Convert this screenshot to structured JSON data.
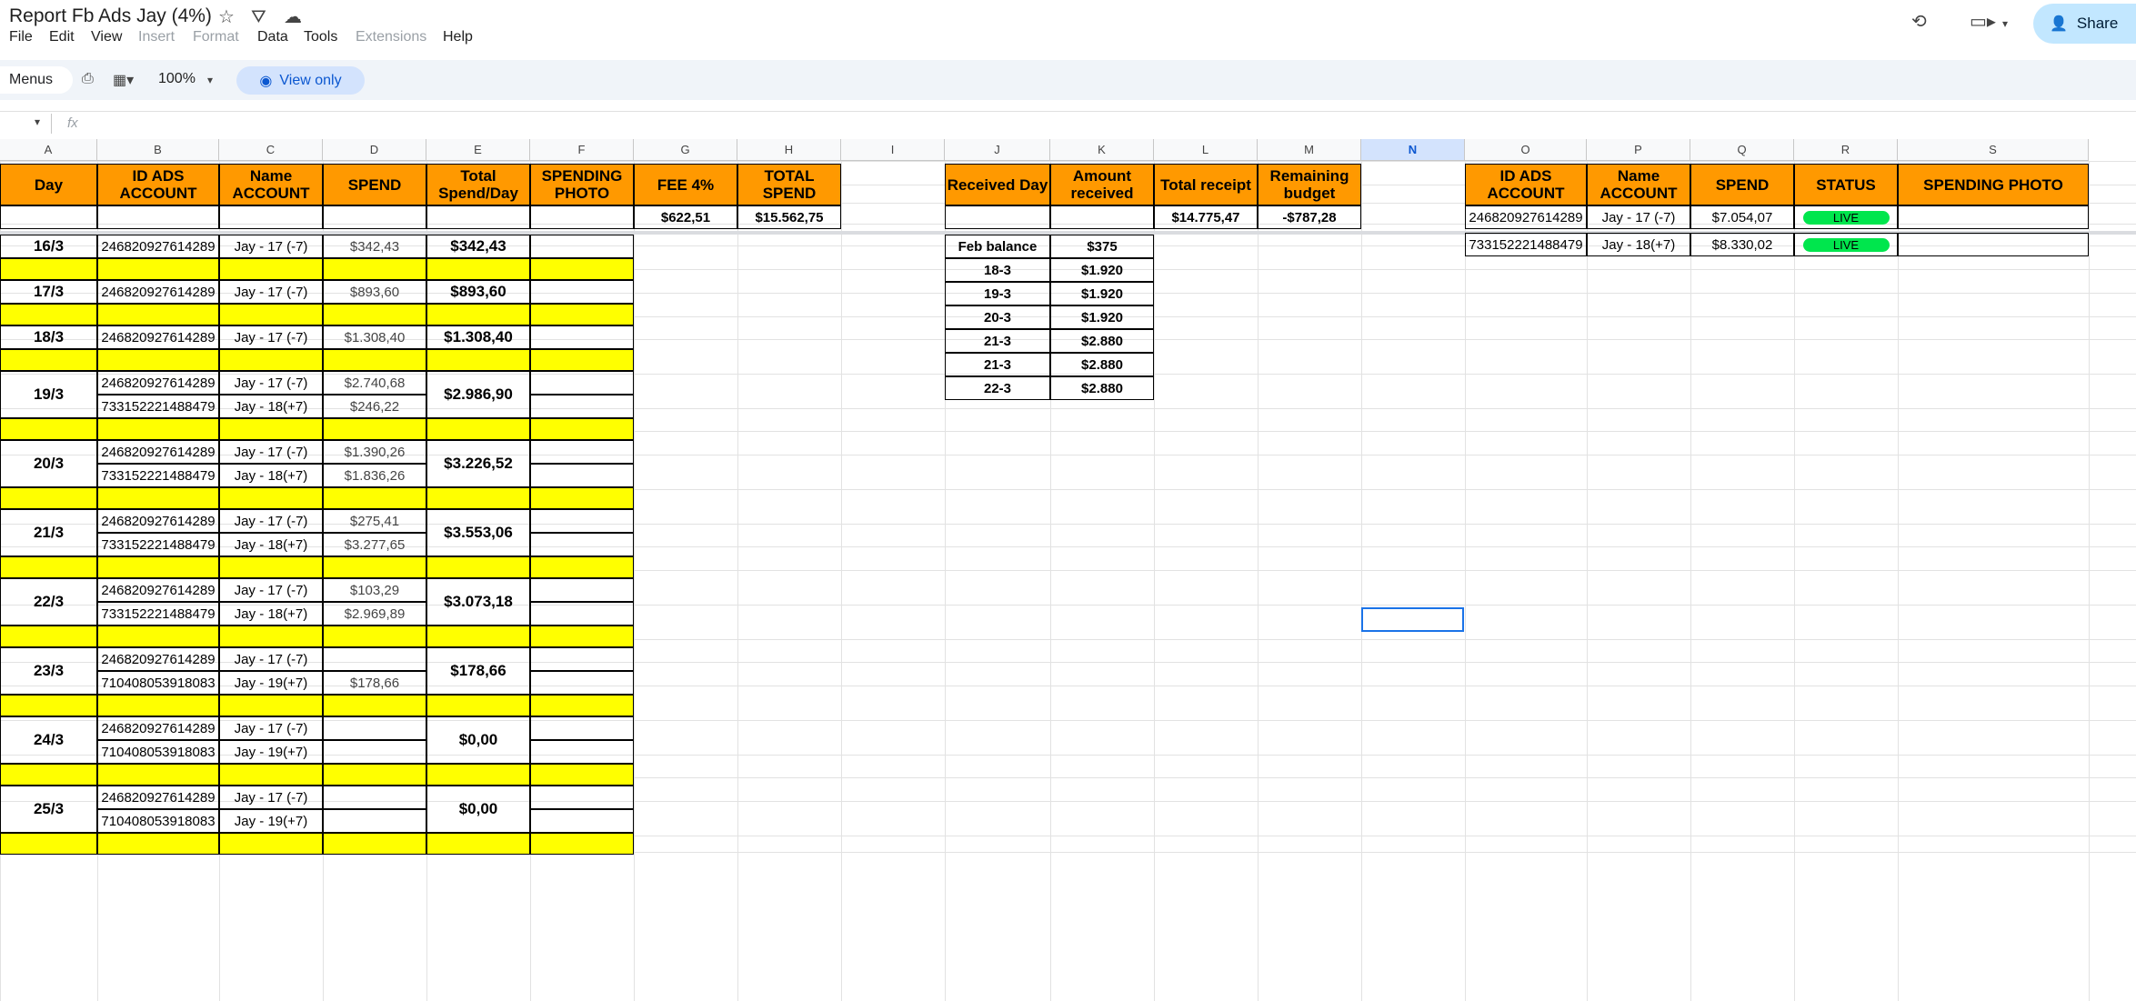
{
  "doc": {
    "title": "Report Fb Ads Jay (4%)"
  },
  "menu": {
    "file": "File",
    "edit": "Edit",
    "view": "View",
    "insert": "Insert",
    "format": "Format",
    "data": "Data",
    "tools": "Tools",
    "extensions": "Extensions",
    "help": "Help"
  },
  "share": {
    "label": "Share"
  },
  "toolbar": {
    "menus": "Menus",
    "zoom": "100%",
    "view_only": "View only"
  },
  "formula": {
    "fx": "fx"
  },
  "columns": [
    "A",
    "B",
    "C",
    "D",
    "E",
    "F",
    "G",
    "H",
    "I",
    "J",
    "K",
    "L",
    "M",
    "N",
    "O",
    "P",
    "Q",
    "R",
    "S"
  ],
  "left": {
    "headers": {
      "day": "Day",
      "id": "ID ADS ACCOUNT",
      "name": "Name ACCOUNT",
      "spend": "SPEND",
      "total": "Total Spend/Day",
      "photo": "SPENDING PHOTO",
      "fee": "FEE 4%",
      "total_spend": "TOTAL SPEND"
    },
    "fee_value": "$622,51",
    "total_spend_value": "$15.562,75",
    "days": [
      {
        "day": "16/3",
        "total": "$342,43",
        "rows": [
          {
            "id": "246820927614289",
            "name": "Jay - 17 (-7)",
            "spend": "$342,43"
          }
        ]
      },
      {
        "day": "17/3",
        "total": "$893,60",
        "rows": [
          {
            "id": "246820927614289",
            "name": "Jay - 17 (-7)",
            "spend": "$893,60"
          }
        ]
      },
      {
        "day": "18/3",
        "total": "$1.308,40",
        "rows": [
          {
            "id": "246820927614289",
            "name": "Jay - 17 (-7)",
            "spend": "$1.308,40"
          }
        ]
      },
      {
        "day": "19/3",
        "total": "$2.986,90",
        "rows": [
          {
            "id": "246820927614289",
            "name": "Jay - 17 (-7)",
            "spend": "$2.740,68"
          },
          {
            "id": "733152221488479",
            "name": "Jay - 18(+7)",
            "spend": "$246,22"
          }
        ]
      },
      {
        "day": "20/3",
        "total": "$3.226,52",
        "rows": [
          {
            "id": "246820927614289",
            "name": "Jay - 17 (-7)",
            "spend": "$1.390,26"
          },
          {
            "id": "733152221488479",
            "name": "Jay - 18(+7)",
            "spend": "$1.836,26"
          }
        ]
      },
      {
        "day": "21/3",
        "total": "$3.553,06",
        "rows": [
          {
            "id": "246820927614289",
            "name": "Jay - 17 (-7)",
            "spend": "$275,41"
          },
          {
            "id": "733152221488479",
            "name": "Jay - 18(+7)",
            "spend": "$3.277,65"
          }
        ]
      },
      {
        "day": "22/3",
        "total": "$3.073,18",
        "rows": [
          {
            "id": "246820927614289",
            "name": "Jay - 17 (-7)",
            "spend": "$103,29"
          },
          {
            "id": "733152221488479",
            "name": "Jay - 18(+7)",
            "spend": "$2.969,89"
          }
        ]
      },
      {
        "day": "23/3",
        "total": "$178,66",
        "rows": [
          {
            "id": "246820927614289",
            "name": "Jay - 17 (-7)",
            "spend": ""
          },
          {
            "id": "710408053918083",
            "name": "Jay - 19(+7)",
            "spend": "$178,66"
          }
        ]
      },
      {
        "day": "24/3",
        "total": "$0,00",
        "rows": [
          {
            "id": "246820927614289",
            "name": "Jay - 17 (-7)",
            "spend": ""
          },
          {
            "id": "710408053918083",
            "name": "Jay - 19(+7)",
            "spend": ""
          }
        ]
      },
      {
        "day": "25/3",
        "total": "$0,00",
        "rows": [
          {
            "id": "246820927614289",
            "name": "Jay - 17 (-7)",
            "spend": ""
          },
          {
            "id": "710408053918083",
            "name": "Jay - 19(+7)",
            "spend": ""
          }
        ]
      }
    ]
  },
  "middle": {
    "headers": {
      "received_day": "Received Day",
      "amount": "Amount received",
      "total_receipt": "Total receipt",
      "remaining": "Remaining budget"
    },
    "total_receipt_value": "$14.775,47",
    "remaining_value": "-$787,28",
    "rows": [
      {
        "day": "Feb balance",
        "amount": "$375"
      },
      {
        "day": "18-3",
        "amount": "$1.920"
      },
      {
        "day": "19-3",
        "amount": "$1.920"
      },
      {
        "day": "20-3",
        "amount": "$1.920"
      },
      {
        "day": "21-3",
        "amount": "$2.880"
      },
      {
        "day": "21-3",
        "amount": "$2.880"
      },
      {
        "day": "22-3",
        "amount": "$2.880"
      }
    ]
  },
  "right": {
    "headers": {
      "id": "ID ADS ACCOUNT",
      "name": "Name ACCOUNT",
      "spend": "SPEND",
      "status": "STATUS",
      "photo": "SPENDING PHOTO"
    },
    "rows": [
      {
        "id": "246820927614289",
        "name": "Jay - 17 (-7)",
        "spend": "$7.054,07",
        "status": "LIVE"
      },
      {
        "id": "733152221488479",
        "name": "Jay - 18(+7)",
        "spend": "$8.330,02",
        "status": "LIVE"
      }
    ]
  },
  "colors": {
    "orange": "#ff9900",
    "yellow": "#ffff00",
    "live": "#00e64d",
    "share_bg": "#c2e7ff"
  }
}
